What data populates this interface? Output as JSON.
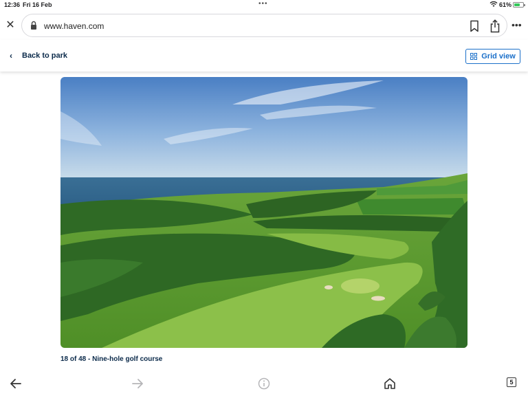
{
  "status_bar": {
    "time": "12:36",
    "date": "Fri 16 Feb",
    "battery": "61%",
    "battery_color": "#34c759"
  },
  "browser": {
    "url": "www.haven.com",
    "close_icon": "close-icon",
    "lock_icon": "lock-icon",
    "bookmark_icon": "bookmark-icon",
    "share_icon": "share-icon",
    "more_icon": "more-icon"
  },
  "header": {
    "back_label": "Back to park",
    "grid_label": "Grid view",
    "accent_color": "#1a6fc9"
  },
  "gallery": {
    "caption": "18 of 48 - Nine-hole golf course",
    "image_alt": "Aerial view of nine-hole golf course by the sea"
  },
  "toolbar": {
    "tab_count": "5",
    "icons": [
      "back-arrow-icon",
      "forward-arrow-icon",
      "info-icon",
      "home-icon",
      "tabs-icon"
    ]
  }
}
